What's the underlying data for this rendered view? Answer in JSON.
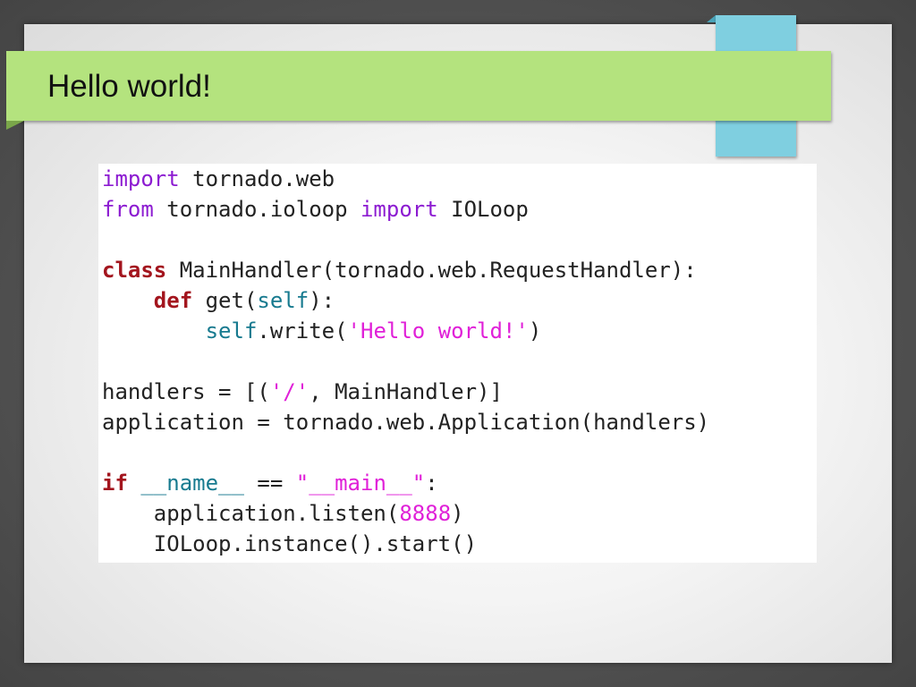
{
  "slide": {
    "title": "Hello world!"
  },
  "colors": {
    "title_bar": "#b4e37e",
    "accent_tab": "#7fcfe0",
    "keyword_import": "#8c1bd1",
    "keyword_def": "#a3151e",
    "builtin": "#177a8f",
    "string": "#e020d8"
  },
  "code": {
    "lines": [
      [
        {
          "t": "import",
          "c": "kw-purple"
        },
        {
          "t": " tornado.web",
          "c": "plain"
        }
      ],
      [
        {
          "t": "from",
          "c": "kw-purple"
        },
        {
          "t": " tornado.ioloop ",
          "c": "plain"
        },
        {
          "t": "import",
          "c": "kw-purple"
        },
        {
          "t": " IOLoop",
          "c": "plain"
        }
      ],
      [],
      [
        {
          "t": "class",
          "c": "kw-red"
        },
        {
          "t": " MainHandler(tornado.web.RequestHandler):",
          "c": "plain"
        }
      ],
      [
        {
          "t": "    ",
          "c": "plain"
        },
        {
          "t": "def",
          "c": "kw-red"
        },
        {
          "t": " get(",
          "c": "plain"
        },
        {
          "t": "self",
          "c": "builtin"
        },
        {
          "t": "):",
          "c": "plain"
        }
      ],
      [
        {
          "t": "        ",
          "c": "plain"
        },
        {
          "t": "self",
          "c": "builtin"
        },
        {
          "t": ".write(",
          "c": "plain"
        },
        {
          "t": "'Hello world!'",
          "c": "str"
        },
        {
          "t": ")",
          "c": "plain"
        }
      ],
      [],
      [
        {
          "t": "handlers = [(",
          "c": "plain"
        },
        {
          "t": "'/'",
          "c": "str"
        },
        {
          "t": ", MainHandler)]",
          "c": "plain"
        }
      ],
      [
        {
          "t": "application = tornado.web.Application(handlers)",
          "c": "plain"
        }
      ],
      [],
      [
        {
          "t": "if",
          "c": "kw-red"
        },
        {
          "t": " ",
          "c": "plain"
        },
        {
          "t": "__name__",
          "c": "builtin"
        },
        {
          "t": " == ",
          "c": "plain"
        },
        {
          "t": "\"__main__\"",
          "c": "str"
        },
        {
          "t": ":",
          "c": "plain"
        }
      ],
      [
        {
          "t": "    application.listen(",
          "c": "plain"
        },
        {
          "t": "8888",
          "c": "num"
        },
        {
          "t": ")",
          "c": "plain"
        }
      ],
      [
        {
          "t": "    IOLoop.instance().start()",
          "c": "plain"
        }
      ]
    ]
  }
}
